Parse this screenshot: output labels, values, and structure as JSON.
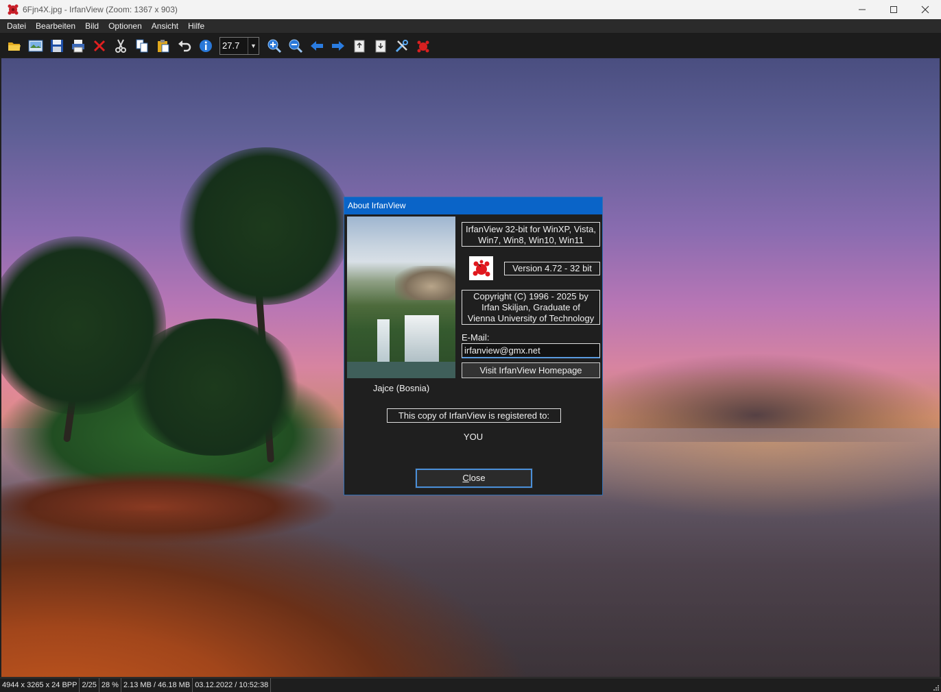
{
  "window": {
    "title": "6Fjn4X.jpg - IrfanView (Zoom: 1367 x 903)",
    "minimize_icon": "minimize-icon",
    "maximize_icon": "maximize-icon",
    "close_icon": "close-icon"
  },
  "menu": {
    "items": [
      "Datei",
      "Bearbeiten",
      "Bild",
      "Optionen",
      "Ansicht",
      "Hilfe"
    ]
  },
  "toolbar": {
    "zoom_value": "27.7",
    "icons": [
      "open-folder-icon",
      "slideshow-icon",
      "save-icon",
      "print-icon",
      "delete-icon",
      "cut-icon",
      "copy-icon",
      "paste-icon",
      "undo-icon",
      "info-icon",
      "zoom-in-icon",
      "zoom-out-icon",
      "previous-icon",
      "next-icon",
      "first-page-icon",
      "last-page-icon",
      "properties-icon",
      "irfanview-logo-icon"
    ]
  },
  "about_dialog": {
    "title": "About  IrfanView",
    "photo_caption": "Jajce (Bosnia)",
    "platform_line1": "IrfanView 32-bit for WinXP, Vista,",
    "platform_line2": "Win7, Win8, Win10, Win11",
    "version": "Version 4.72 - 32 bit",
    "copyright_line1": "Copyright (C) 1996 - 2025 by",
    "copyright_line2": "Irfan Skiljan, Graduate of",
    "copyright_line3": "Vienna University of Technology",
    "email_label": "E-Mail:",
    "email_value": "irfanview@gmx.net",
    "homepage_button": "Visit IrfanView Homepage",
    "registered_label": "This copy of IrfanView is registered to:",
    "registered_name": "YOU",
    "close_button_accel": "C",
    "close_button_rest": "lose"
  },
  "statusbar": {
    "dimensions": "4944 x 3265 x 24 BPP",
    "index": "2/25",
    "zoom": "28 %",
    "size": "2.13 MB / 46.18 MB",
    "datetime": "03.12.2022 / 10:52:38"
  },
  "colors": {
    "accent": "#0a64c8",
    "dialog_bg": "#1f1f1f",
    "menubar_bg": "#2b2b2b",
    "toolbar_bg": "#1c1c1c"
  }
}
